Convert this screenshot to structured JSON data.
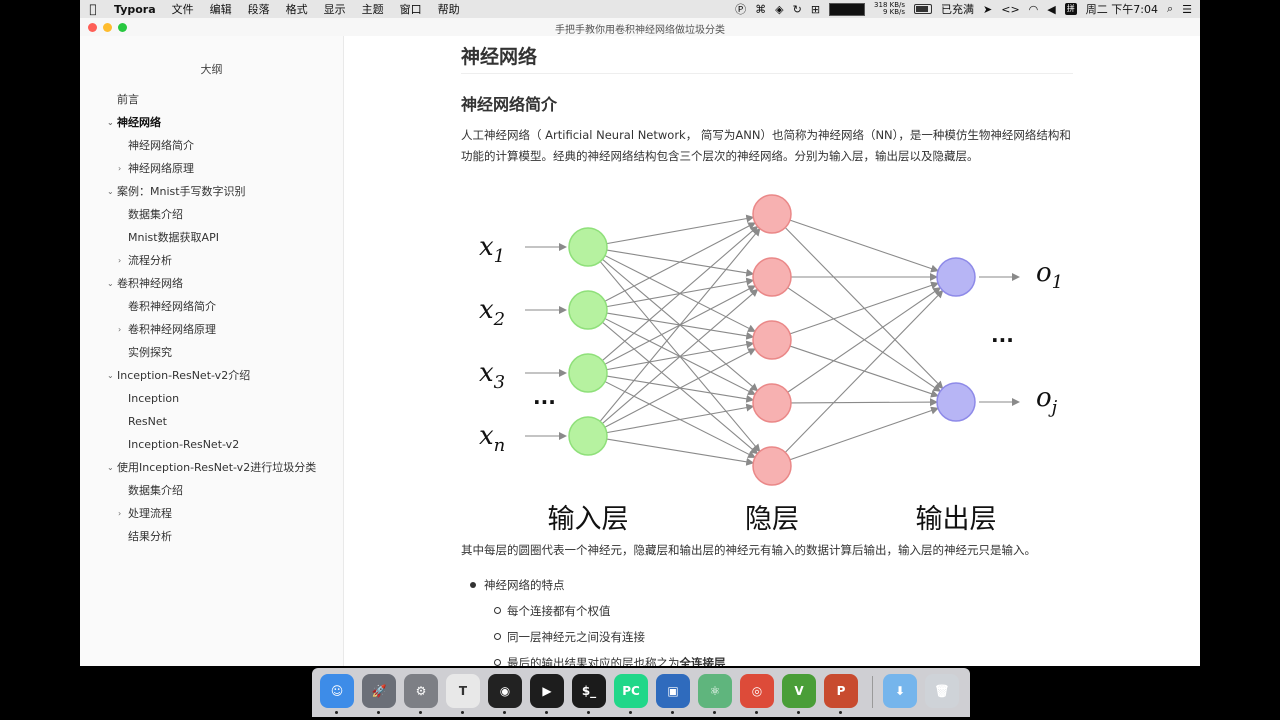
{
  "menubar": {
    "app_name": "Typora",
    "menus": [
      "文件",
      "编辑",
      "段落",
      "格式",
      "显示",
      "主题",
      "窗口",
      "帮助"
    ],
    "net_up": "318 KB/s",
    "net_down": "9 KB/s",
    "battery_label": "已充满",
    "datetime": "周二 下午7:04",
    "ime_label": "拼"
  },
  "window": {
    "doc_title": "手把手教你用卷积神经网络做垃圾分类"
  },
  "sidebar": {
    "title": "大纲",
    "items": [
      {
        "label": "前言",
        "level": 1,
        "chevron": ""
      },
      {
        "label": "神经网络",
        "level": 1,
        "chevron": "v",
        "active": true
      },
      {
        "label": "神经网络简介",
        "level": 2,
        "chevron": ""
      },
      {
        "label": "神经网络原理",
        "level": 2,
        "chevron": ">"
      },
      {
        "label": "案例：Mnist手写数字识别",
        "level": 1,
        "chevron": "v"
      },
      {
        "label": "数据集介绍",
        "level": 2,
        "chevron": ""
      },
      {
        "label": "Mnist数据获取API",
        "level": 2,
        "chevron": ""
      },
      {
        "label": "流程分析",
        "level": 2,
        "chevron": ">"
      },
      {
        "label": "卷积神经网络",
        "level": 1,
        "chevron": "v"
      },
      {
        "label": "卷积神经网络简介",
        "level": 2,
        "chevron": ""
      },
      {
        "label": "卷积神经网络原理",
        "level": 2,
        "chevron": ">"
      },
      {
        "label": "实例探究",
        "level": 2,
        "chevron": ""
      },
      {
        "label": "Inception-ResNet-v2介绍",
        "level": 1,
        "chevron": "v"
      },
      {
        "label": "Inception",
        "level": 2,
        "chevron": ""
      },
      {
        "label": "ResNet",
        "level": 2,
        "chevron": ""
      },
      {
        "label": "Inception-ResNet-v2",
        "level": 2,
        "chevron": ""
      },
      {
        "label": "使用Inception-ResNet-v2进行垃圾分类",
        "level": 1,
        "chevron": "v"
      },
      {
        "label": "数据集介绍",
        "level": 2,
        "chevron": ""
      },
      {
        "label": "处理流程",
        "level": 2,
        "chevron": ">"
      },
      {
        "label": "结果分析",
        "level": 2,
        "chevron": ""
      }
    ]
  },
  "content": {
    "h1": "神经网络",
    "h2": "神经网络简介",
    "intro": "人工神经网络（ Artificial Neural Network， 简写为ANN）也简称为神经网络（NN），是一种模仿生物神经网络结构和功能的计算模型。经典的神经网络结构包含三个层次的神经网络。分别为输入层，输出层以及隐藏层。",
    "caption": "其中每层的圆圈代表一个神经元，隐藏层和输出层的神经元有输入的数据计算后输出，输入层的神经元只是输入。",
    "bullet_main": "神经网络的特点",
    "bullet_subs": [
      "每个连接都有个权值",
      "同一层神经元之间没有连接"
    ],
    "bullet_last_prefix": "最后的输出结果对应的层也称之为",
    "bullet_last_bold": "全连接层"
  },
  "diagram": {
    "input_labels": [
      "x1",
      "x2",
      "x3",
      "xn"
    ],
    "input_sub": [
      "1",
      "2",
      "3",
      "n"
    ],
    "output_labels": [
      "o1",
      "oj"
    ],
    "output_sub": [
      "1",
      "j"
    ],
    "ellipsis": "...",
    "layer_labels": [
      "输入层",
      "隐层",
      "输出层"
    ],
    "colors": {
      "input": "#b6f2a0",
      "input_stroke": "#8fe07a",
      "hidden": "#f7b1b1",
      "hidden_stroke": "#ea8888",
      "output": "#b7b5f5",
      "output_stroke": "#8e8ae8",
      "edge": "#8a8a8a"
    }
  },
  "dock": {
    "apps": [
      {
        "name": "finder",
        "glyph": "☺",
        "color": "#3d8ce8"
      },
      {
        "name": "launchpad",
        "glyph": "🚀",
        "color": "#6b6f78"
      },
      {
        "name": "system-preferences",
        "glyph": "⚙",
        "color": "#7d7f85"
      },
      {
        "name": "typora",
        "glyph": "T",
        "color": "#e8e8e8"
      },
      {
        "name": "obs",
        "glyph": "◉",
        "color": "#222222"
      },
      {
        "name": "player",
        "glyph": "▶",
        "color": "#1d1d1d"
      },
      {
        "name": "terminal",
        "glyph": "$_",
        "color": "#1b1b1b"
      },
      {
        "name": "pycharm",
        "glyph": "PC",
        "color": "#21d789"
      },
      {
        "name": "virtualbox",
        "glyph": "▣",
        "color": "#2f6bbd"
      },
      {
        "name": "atom",
        "glyph": "⚛",
        "color": "#5fb57d"
      },
      {
        "name": "chrome",
        "glyph": "◎",
        "color": "#dd4b39"
      },
      {
        "name": "vim",
        "glyph": "V",
        "color": "#4a9e38"
      },
      {
        "name": "powerpoint",
        "glyph": "P",
        "color": "#c84b2f"
      },
      {
        "name": "downloads-folder",
        "glyph": "⬇",
        "color": "#75b5ec"
      },
      {
        "name": "trash",
        "glyph": "🗑",
        "color": "#cfd3d8"
      }
    ]
  }
}
